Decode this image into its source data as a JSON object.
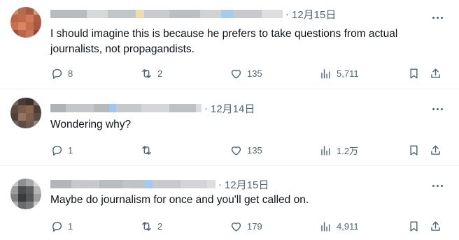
{
  "replies": [
    {
      "date": "12月15日",
      "text": "I should imagine this is because he prefers to take questions from actual journalists, not propagandists.",
      "counts": {
        "reply": "8",
        "retweet": "2",
        "like": "135",
        "views": "5,711"
      }
    },
    {
      "date": "12月14日",
      "text": "Wondering why?",
      "counts": {
        "reply": "1",
        "retweet": "",
        "like": "135",
        "views": "1.2万"
      }
    },
    {
      "date": "12月15日",
      "text": "Maybe do journalism for once and you'll get called on.",
      "counts": {
        "reply": "1",
        "retweet": "2",
        "like": "179",
        "views": "4,911"
      }
    }
  ],
  "icons": {
    "reply": "reply-bubble-icon",
    "retweet": "retweet-icon",
    "like": "heart-icon",
    "views": "views-chart-icon",
    "bookmark": "bookmark-icon",
    "share": "share-icon",
    "more": "more-dots-icon"
  },
  "colors": {
    "text": "#0f1419",
    "secondary": "#536471",
    "divider": "#eff3f4"
  }
}
